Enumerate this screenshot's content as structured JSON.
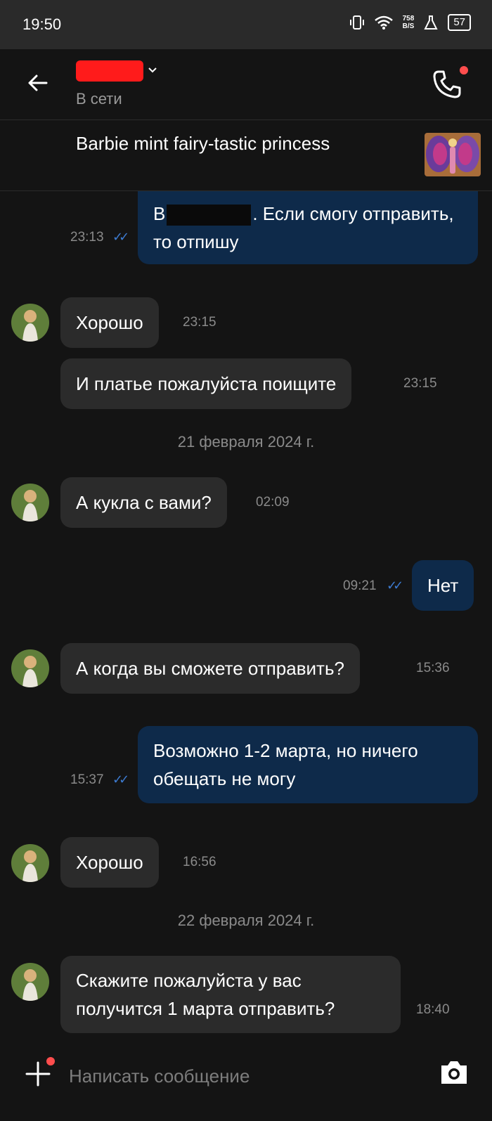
{
  "status_bar": {
    "time": "19:50",
    "net_speed_value": "758",
    "net_speed_unit": "B/S",
    "battery": "57"
  },
  "header": {
    "contact_status": "В сети"
  },
  "product": {
    "title": "Barbie mint fairy-tastic princess"
  },
  "messages": [
    {
      "dir": "out",
      "text_before": "В",
      "text_after": ". Если смогу отправить, то отпишу",
      "time": "23:13"
    },
    {
      "dir": "in",
      "text": "Хорошо",
      "time": "23:15"
    },
    {
      "dir": "in",
      "text": "И платье пожалуйста поищите",
      "time": "23:15"
    },
    {
      "dir": "in",
      "text": "А кукла с вами?",
      "time": "02:09"
    },
    {
      "dir": "out",
      "text": "Нет",
      "time": "09:21"
    },
    {
      "dir": "in",
      "text": "А когда вы сможете отправить?",
      "time": "15:36"
    },
    {
      "dir": "out",
      "text": "Возможно 1-2 марта, но ничего обещать не могу",
      "time": "15:37"
    },
    {
      "dir": "in",
      "text": "Хорошо",
      "time": "16:56"
    },
    {
      "dir": "in",
      "text": "Скажите пожалуйста у вас получится 1 марта отправить?",
      "time": "18:40"
    }
  ],
  "date_separators": [
    "21 февраля 2024 г.",
    "22 февраля 2024 г."
  ],
  "composer": {
    "placeholder": "Написать сообщение"
  },
  "colors": {
    "background": "#141414",
    "incoming_bubble": "#2b2b2b",
    "outgoing_bubble": "#0e2a4a",
    "read_ticks": "#3d7bd1",
    "notification_dot": "#ff4d4d"
  }
}
